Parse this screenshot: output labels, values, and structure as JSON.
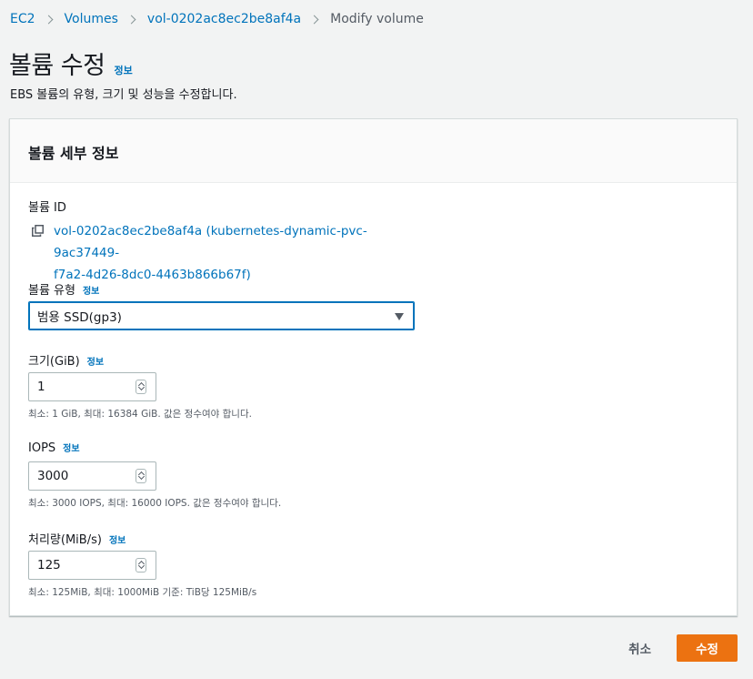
{
  "breadcrumb": {
    "items": [
      "EC2",
      "Volumes",
      "vol-0202ac8ec2be8af4a"
    ],
    "current": "Modify volume"
  },
  "page": {
    "title": "볼륨 수정",
    "info": "정보",
    "description": "EBS 볼륨의 유형, 크기 및 성능을 수정합니다."
  },
  "panel": {
    "title": "볼륨 세부 정보",
    "volume_id_label": "볼륨 ID",
    "volume_id_line1": "vol-0202ac8ec2be8af4a (kubernetes-dynamic-pvc-9ac37449-",
    "volume_id_line2": "f7a2-4d26-8dc0-4463b866b67f)",
    "volume_type": {
      "label": "볼륨 유형",
      "info": "정보",
      "selected": "범용 SSD(gp3)"
    },
    "size": {
      "label": "크기(GiB)",
      "info": "정보",
      "value": "1",
      "hint": "최소: 1 GiB, 최대: 16384 GiB. 값은 정수여야 합니다."
    },
    "iops": {
      "label": "IOPS",
      "info": "정보",
      "value": "3000",
      "hint": "최소: 3000 IOPS, 최대: 16000 IOPS. 값은 정수여야 합니다."
    },
    "throughput": {
      "label": "처리량(MiB/s)",
      "info": "정보",
      "value": "125",
      "hint": "최소: 125MiB, 최대: 1000MiB 기준: TiB당 125MiB/s"
    }
  },
  "actions": {
    "cancel": "취소",
    "submit": "수정"
  },
  "colors": {
    "link": "#0073bb",
    "primary": "#ec7211",
    "background": "#f2f3f3"
  }
}
